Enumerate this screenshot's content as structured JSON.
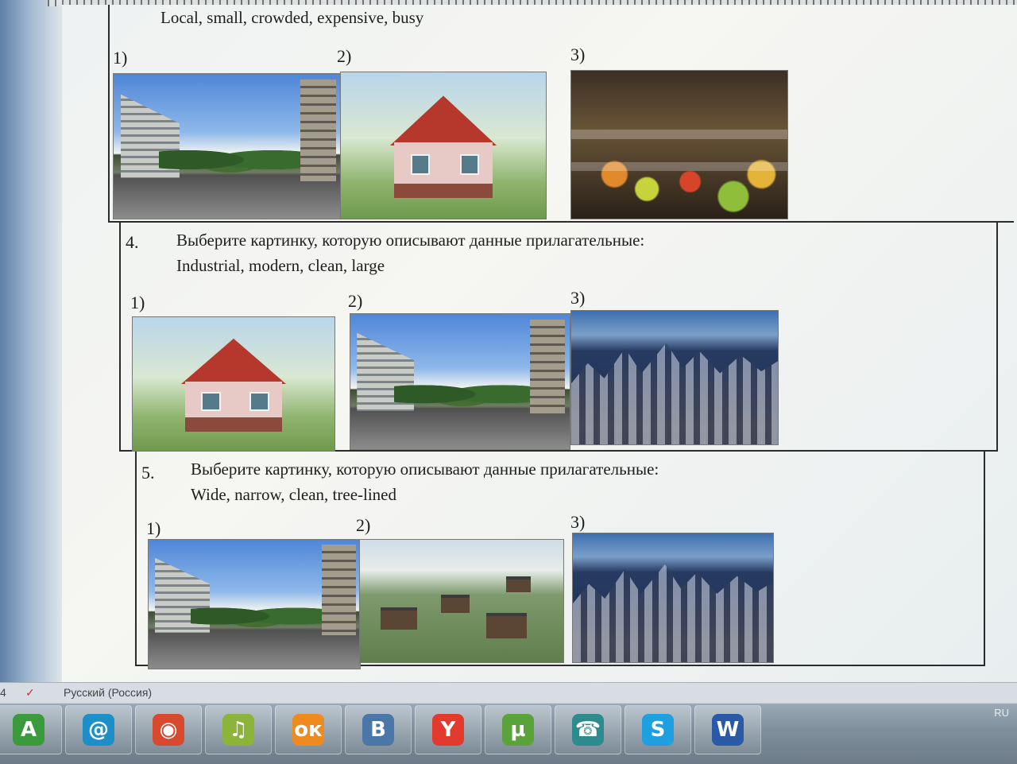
{
  "document": {
    "top_adjectives": "Local, small,  crowded, expensive, busy",
    "section3": {
      "options": [
        "1)",
        "2)",
        "3)"
      ]
    },
    "section4": {
      "number": "4.",
      "instruction": "Выберите картинку, которую описывают данные прилагательные:",
      "adjectives": "Industrial, modern, clean, large",
      "options": [
        "1)",
        "2)",
        "3)"
      ]
    },
    "section5": {
      "number": "5.",
      "instruction": "Выберите картинку, которую описывают данные прилагательные:",
      "adjectives": "Wide, narrow, clean, tree-lined",
      "options": [
        "1)",
        "2)",
        "3)"
      ]
    }
  },
  "status_bar": {
    "page": "4",
    "language": "Русский (Россия)"
  },
  "taskbar": {
    "apps": [
      {
        "name": "a-app-icon",
        "glyph": "A",
        "color": "#3b9a3b"
      },
      {
        "name": "mail-icon",
        "glyph": "@",
        "color": "#1d8fc8"
      },
      {
        "name": "chrome-icon",
        "glyph": "◉",
        "color": "#d84a2e"
      },
      {
        "name": "music-icon",
        "glyph": "♫",
        "color": "#8cb33a"
      },
      {
        "name": "odnoklassniki-icon",
        "glyph": "ок",
        "color": "#ef8a1e"
      },
      {
        "name": "vk-icon",
        "glyph": "B",
        "color": "#4a76a8"
      },
      {
        "name": "yandex-browser-icon",
        "glyph": "Y",
        "color": "#e23b2e"
      },
      {
        "name": "utorrent-icon",
        "glyph": "µ",
        "color": "#5aa33a"
      },
      {
        "name": "phone-icon",
        "glyph": "☎",
        "color": "#2d8b8e"
      },
      {
        "name": "skype-icon",
        "glyph": "S",
        "color": "#1ea0e0"
      },
      {
        "name": "word-icon",
        "glyph": "W",
        "color": "#2a5aa6"
      }
    ],
    "tray_lang": "RU"
  }
}
